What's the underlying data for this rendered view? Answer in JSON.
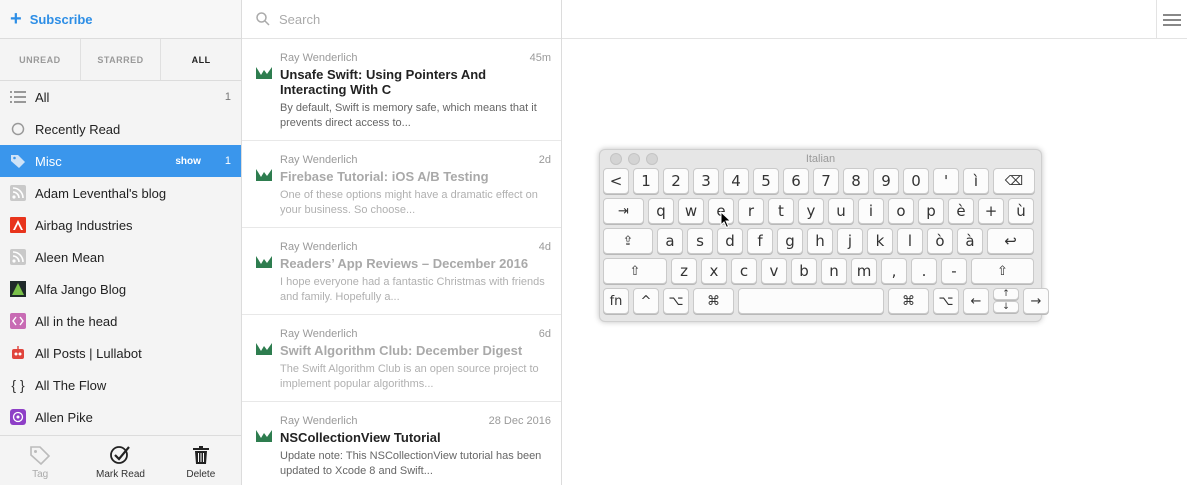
{
  "sidebar": {
    "subscribe_label": "Subscribe",
    "filters": [
      "UNREAD",
      "STARRED",
      "ALL"
    ],
    "feeds": [
      {
        "label": "All",
        "count": "1",
        "icon": "list-icon"
      },
      {
        "label": "Recently Read",
        "count": "",
        "icon": "circle-icon"
      },
      {
        "label": "Misc",
        "count": "1",
        "show": "show",
        "icon": "tag-icon"
      },
      {
        "label": "Adam Leventhal's blog",
        "count": "",
        "icon": "rss-icon"
      },
      {
        "label": "Airbag Industries",
        "count": "",
        "icon": "airbag-favicon"
      },
      {
        "label": "Aleen Mean",
        "count": "",
        "icon": "rss-icon"
      },
      {
        "label": "Alfa Jango Blog",
        "count": "",
        "icon": "alfajango-favicon"
      },
      {
        "label": "All in the head",
        "count": "",
        "icon": "code-favicon"
      },
      {
        "label": "All Posts | Lullabot",
        "count": "",
        "icon": "robot-favicon"
      },
      {
        "label": "All The Flow",
        "count": "",
        "icon": "braces-favicon"
      },
      {
        "label": "Allen Pike",
        "count": "",
        "icon": "allenpike-favicon"
      }
    ],
    "bottom": {
      "tag": "Tag",
      "mark_read": "Mark Read",
      "delete": "Delete"
    }
  },
  "search": {
    "placeholder": "Search"
  },
  "articles": [
    {
      "source": "Ray Wenderlich",
      "time": "45m",
      "title": "Unsafe Swift: Using Pointers And Interacting With C",
      "summary": "By default, Swift is memory safe, which means that it prevents direct access to...",
      "read": false
    },
    {
      "source": "Ray Wenderlich",
      "time": "2d",
      "title": "Firebase Tutorial: iOS A/B Testing",
      "summary": "One of these options might have a dramatic effect on your business. So choose...",
      "read": true
    },
    {
      "source": "Ray Wenderlich",
      "time": "4d",
      "title": "Readers’ App Reviews – December 2016",
      "summary": "I hope everyone had a fantastic Christmas with friends and family. Hopefully a...",
      "read": true
    },
    {
      "source": "Ray Wenderlich",
      "time": "6d",
      "title": "Swift Algorithm Club: December Digest",
      "summary": "The Swift Algorithm Club is an open source project to implement popular algorithms...",
      "read": true
    },
    {
      "source": "Ray Wenderlich",
      "time": "28 Dec 2016",
      "title": "NSCollectionView Tutorial",
      "summary": "Update note: This NSCollectionView tutorial has been updated to Xcode 8 and Swift...",
      "read": false
    }
  ],
  "keyboard": {
    "title": "Italian",
    "row1": [
      "<",
      "1",
      "2",
      "3",
      "4",
      "5",
      "6",
      "7",
      "8",
      "9",
      "0",
      "'",
      "ì",
      "⌫"
    ],
    "row2": [
      "⇥",
      "q",
      "w",
      "e",
      "r",
      "t",
      "y",
      "u",
      "i",
      "o",
      "p",
      "è",
      "+",
      "ù"
    ],
    "row3": [
      "⇪",
      "a",
      "s",
      "d",
      "f",
      "g",
      "h",
      "j",
      "k",
      "l",
      "ò",
      "à",
      "↩"
    ],
    "row4": [
      "⇧",
      "z",
      "x",
      "c",
      "v",
      "b",
      "n",
      "m",
      ",",
      ".",
      "-",
      "⇧"
    ],
    "row5": [
      "fn",
      "^",
      "⌥",
      "⌘",
      "",
      "⌘",
      "⌥",
      "←",
      "↑",
      "↓",
      "→"
    ]
  },
  "colors": {
    "accent": "#3a96ec",
    "subscribe": "#2d8ee6",
    "feed_logo": "#2e7d4f"
  }
}
